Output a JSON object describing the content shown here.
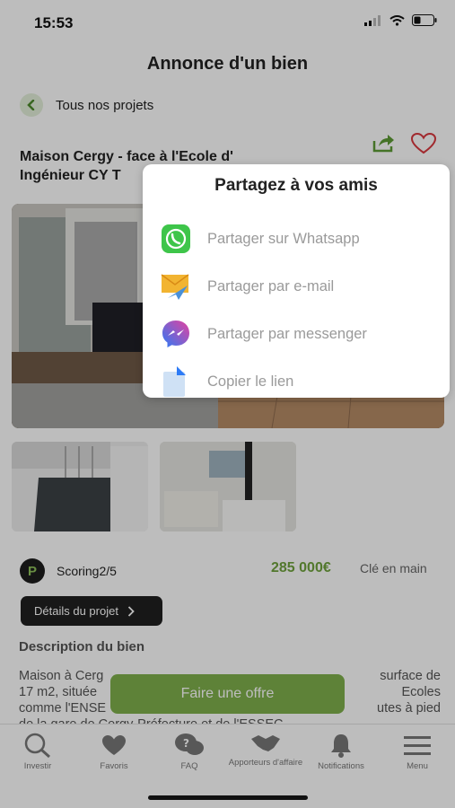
{
  "status": {
    "time": "15:53"
  },
  "header": {
    "title": "Annonce d'un bien"
  },
  "back": {
    "label": "Tous nos projets"
  },
  "property": {
    "title_line1": "Maison Cergy - face à l'Ecole d'",
    "title_line2": "Ingénieur CY T"
  },
  "scoring": {
    "logo": "P",
    "label": "Scoring2/5"
  },
  "price": {
    "value": "285 000€",
    "label": "Clé en main"
  },
  "details_button": "Détails du projet",
  "description": {
    "title": "Description du bien",
    "text_line1": "Maison à Cerg",
    "text_line1b": "surface de",
    "text_line2": "17 m2, située",
    "text_line2b": "Ecoles",
    "text_line3": "comme l'ENSE",
    "text_line3b": "utes à pied",
    "text_line4": "de la gare de Cergy-Préfecture et de l'ESSEC"
  },
  "offer_button": "Faire une offre",
  "tabs": [
    {
      "label": "Investir",
      "icon": "search-icon"
    },
    {
      "label": "Favoris",
      "icon": "heart-icon"
    },
    {
      "label": "FAQ",
      "icon": "faq-icon"
    },
    {
      "label": "Apporteurs d'affaire",
      "icon": "handshake-icon"
    },
    {
      "label": "Notifications",
      "icon": "bell-icon"
    },
    {
      "label": "Menu",
      "icon": "menu-icon"
    }
  ],
  "share": {
    "title": "Partagez à vos amis",
    "options": [
      {
        "label": "Partager sur Whatsapp",
        "icon": "whatsapp-icon"
      },
      {
        "label": "Partager par e-mail",
        "icon": "email-icon"
      },
      {
        "label": "Partager par messenger",
        "icon": "messenger-icon"
      },
      {
        "label": "Copier le lien",
        "icon": "copy-link-icon"
      }
    ]
  },
  "colors": {
    "accent": "#7fb04c",
    "price": "#6fa33d",
    "dark": "#1f1f1f"
  }
}
